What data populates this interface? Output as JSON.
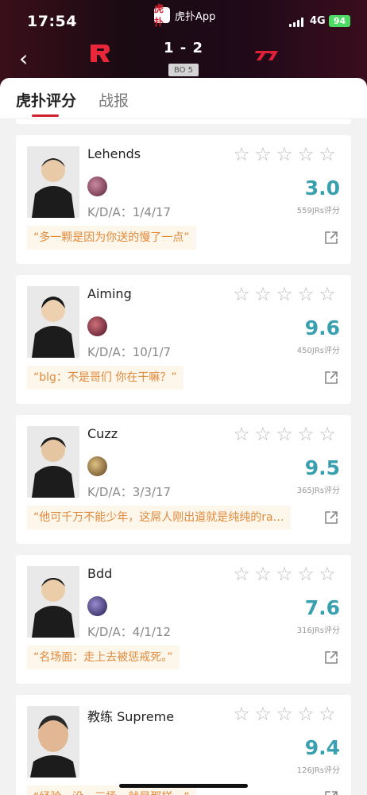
{
  "status_bar": {
    "time": "17:54",
    "app_logo_text": "虎扑",
    "app_name": "虎扑App",
    "network": "4G",
    "battery": "94"
  },
  "match": {
    "score": "1 - 2",
    "series": "BO 5",
    "left_team_icon": "kt-rolster-logo",
    "right_team_icon": "t1-logo",
    "accent_color": "#d0202e"
  },
  "tabs": [
    {
      "label": "虎扑评分",
      "active": true
    },
    {
      "label": "战报",
      "active": false
    }
  ],
  "rating_color": "#3aa0b0",
  "players": [
    {
      "name": "Lehends",
      "kda": "K/D/A：1/4/17",
      "rating": "3.0",
      "count": "559JRs评分",
      "comment": "“多一颗是因为你送的慢了一点”",
      "champ_color": "#8a3a5a"
    },
    {
      "name": "Aiming",
      "kda": "K/D/A：10/1/7",
      "rating": "9.6",
      "count": "450JRs评分",
      "comment": "“blg：不是哥们 你在干嘛？”",
      "champ_color": "#7a2a4a"
    },
    {
      "name": "Cuzz",
      "kda": "K/D/A：3/3/17",
      "rating": "9.5",
      "count": "365JRs评分",
      "comment": "“他可千万不能少年，这屌人刚出道就是纯纯的ra…",
      "champ_color": "#8a6a3a"
    },
    {
      "name": "Bdd",
      "kda": "K/D/A：4/1/12",
      "rating": "7.6",
      "count": "316JRs评分",
      "comment": "“名场面：走上去被惩戒死。”",
      "champ_color": "#3a3a7a"
    },
    {
      "name": "教练 Supreme",
      "kda": "",
      "rating": "9.4",
      "count": "126JRs评分",
      "comment": "“经验…没…三场…就是那样…”",
      "champ_color": ""
    }
  ]
}
